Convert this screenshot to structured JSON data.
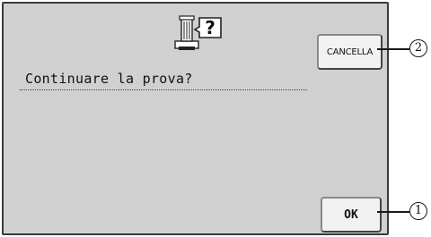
{
  "dialog": {
    "message": "Continuare la prova?",
    "cancel_label": "CANCELLA",
    "ok_label": "OK"
  },
  "callouts": {
    "cancel_number": "2",
    "ok_number": "1"
  }
}
